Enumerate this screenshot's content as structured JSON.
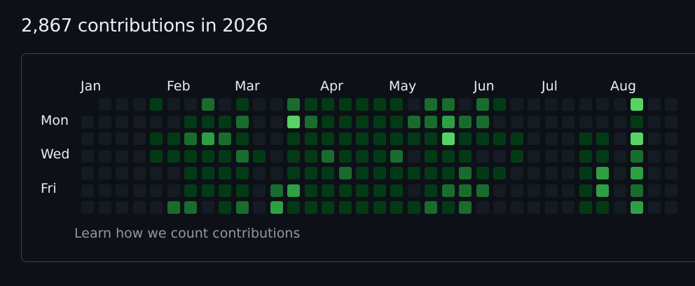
{
  "header": {
    "title": "2,867 contributions in 2026"
  },
  "months": [
    "Jan",
    "Feb",
    "Mar",
    "Apr",
    "May",
    "Jun",
    "Jul",
    "Aug"
  ],
  "days": [
    "Mon",
    "Wed",
    "Fri"
  ],
  "footer": {
    "learn_link": "Learn how we count contributions"
  },
  "colors": {
    "background": "#0d1117",
    "border": "#3d444d",
    "level0": "#151b23",
    "level1": "#033a16",
    "level2": "#196c2e",
    "level3": "#2ea043",
    "level4": "#56d364"
  },
  "contribution_levels": [
    "xxx0000000000000000000000000000000000000000000000",
    "01010000000000000000000000000000000000000000000000",
    "000000000000000000000000000000000000000000000000",
    "0000000000000000000000000000000000000000000000000",
    "0000000000000000000000000000000000000000000000000",
    "0000000000000000000000000000000000000000000000000",
    "0000000000000000000000000000000000000000000000000"
  ],
  "weeks": [
    [
      -1,
      0,
      0,
      0,
      0,
      0,
      0
    ],
    [
      0,
      0,
      0,
      0,
      0,
      0,
      0
    ],
    [
      0,
      0,
      0,
      0,
      0,
      0,
      0
    ],
    [
      0,
      0,
      0,
      0,
      0,
      0,
      0
    ],
    [
      1,
      0,
      1,
      1,
      0,
      0,
      0
    ],
    [
      0,
      0,
      1,
      1,
      0,
      0,
      2
    ],
    [
      0,
      1,
      2,
      1,
      1,
      1,
      2
    ],
    [
      2,
      1,
      3,
      1,
      1,
      1,
      0
    ],
    [
      0,
      1,
      2,
      1,
      1,
      1,
      1
    ],
    [
      1,
      2,
      1,
      2,
      1,
      1,
      2
    ],
    [
      0,
      0,
      0,
      1,
      0,
      0,
      0
    ],
    [
      0,
      0,
      0,
      0,
      0,
      2,
      3
    ],
    [
      2,
      4,
      1,
      1,
      1,
      3,
      1
    ],
    [
      1,
      2,
      1,
      1,
      1,
      1,
      1
    ],
    [
      1,
      1,
      1,
      2,
      1,
      1,
      1
    ],
    [
      1,
      1,
      1,
      1,
      2,
      1,
      1
    ],
    [
      1,
      1,
      1,
      1,
      1,
      1,
      1
    ],
    [
      1,
      1,
      1,
      1,
      1,
      1,
      1
    ],
    [
      1,
      1,
      1,
      2,
      1,
      1,
      1
    ],
    [
      0,
      2,
      1,
      0,
      1,
      0,
      1
    ],
    [
      2,
      2,
      1,
      1,
      1,
      1,
      2
    ],
    [
      2,
      3,
      4,
      1,
      1,
      2,
      1
    ],
    [
      0,
      2,
      1,
      1,
      2,
      2,
      2
    ],
    [
      2,
      2,
      1,
      0,
      1,
      2,
      0
    ],
    [
      1,
      0,
      1,
      0,
      1,
      0,
      0
    ],
    [
      0,
      0,
      1,
      1,
      0,
      0,
      0
    ],
    [
      0,
      0,
      0,
      0,
      0,
      0,
      0
    ],
    [
      0,
      0,
      0,
      0,
      0,
      0,
      0
    ],
    [
      0,
      0,
      0,
      0,
      0,
      0,
      0
    ],
    [
      0,
      0,
      1,
      1,
      1,
      1,
      1
    ],
    [
      0,
      0,
      1,
      1,
      3,
      3,
      1
    ],
    [
      0,
      0,
      0,
      0,
      0,
      0,
      0
    ],
    [
      4,
      1,
      4,
      2,
      3,
      2,
      3
    ],
    [
      0,
      0,
      0,
      0,
      0,
      0,
      0
    ],
    [
      0,
      0,
      0,
      0,
      0,
      0,
      0
    ]
  ]
}
